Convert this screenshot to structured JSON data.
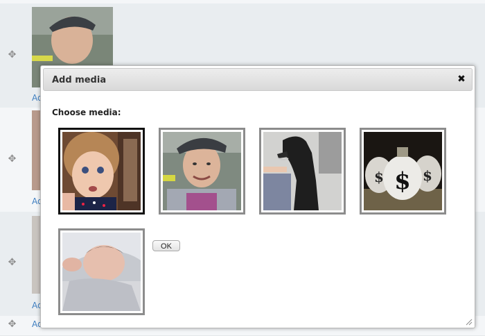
{
  "background_rows": [
    {
      "link": "Add",
      "handle_icon": "move-icon"
    },
    {
      "link": "Add",
      "handle_icon": "move-icon"
    },
    {
      "link": "Add",
      "handle_icon": "move-icon"
    },
    {
      "link": "Add",
      "handle_icon": "move-icon"
    }
  ],
  "dialog": {
    "title": "Add media",
    "close_icon": "close-icon",
    "choose_label": "Choose media:",
    "ok_label": "OK",
    "media": [
      {
        "name": "toddler-portrait",
        "selected": true
      },
      {
        "name": "woman-with-cap",
        "selected": false
      },
      {
        "name": "black-dog",
        "selected": false
      },
      {
        "name": "money-bags",
        "selected": false
      },
      {
        "name": "newborn-baby",
        "selected": false
      }
    ]
  },
  "colors": {
    "link": "#3f7fc1",
    "selected_border": "#111111",
    "thumb_border": "#8c8c8c"
  }
}
